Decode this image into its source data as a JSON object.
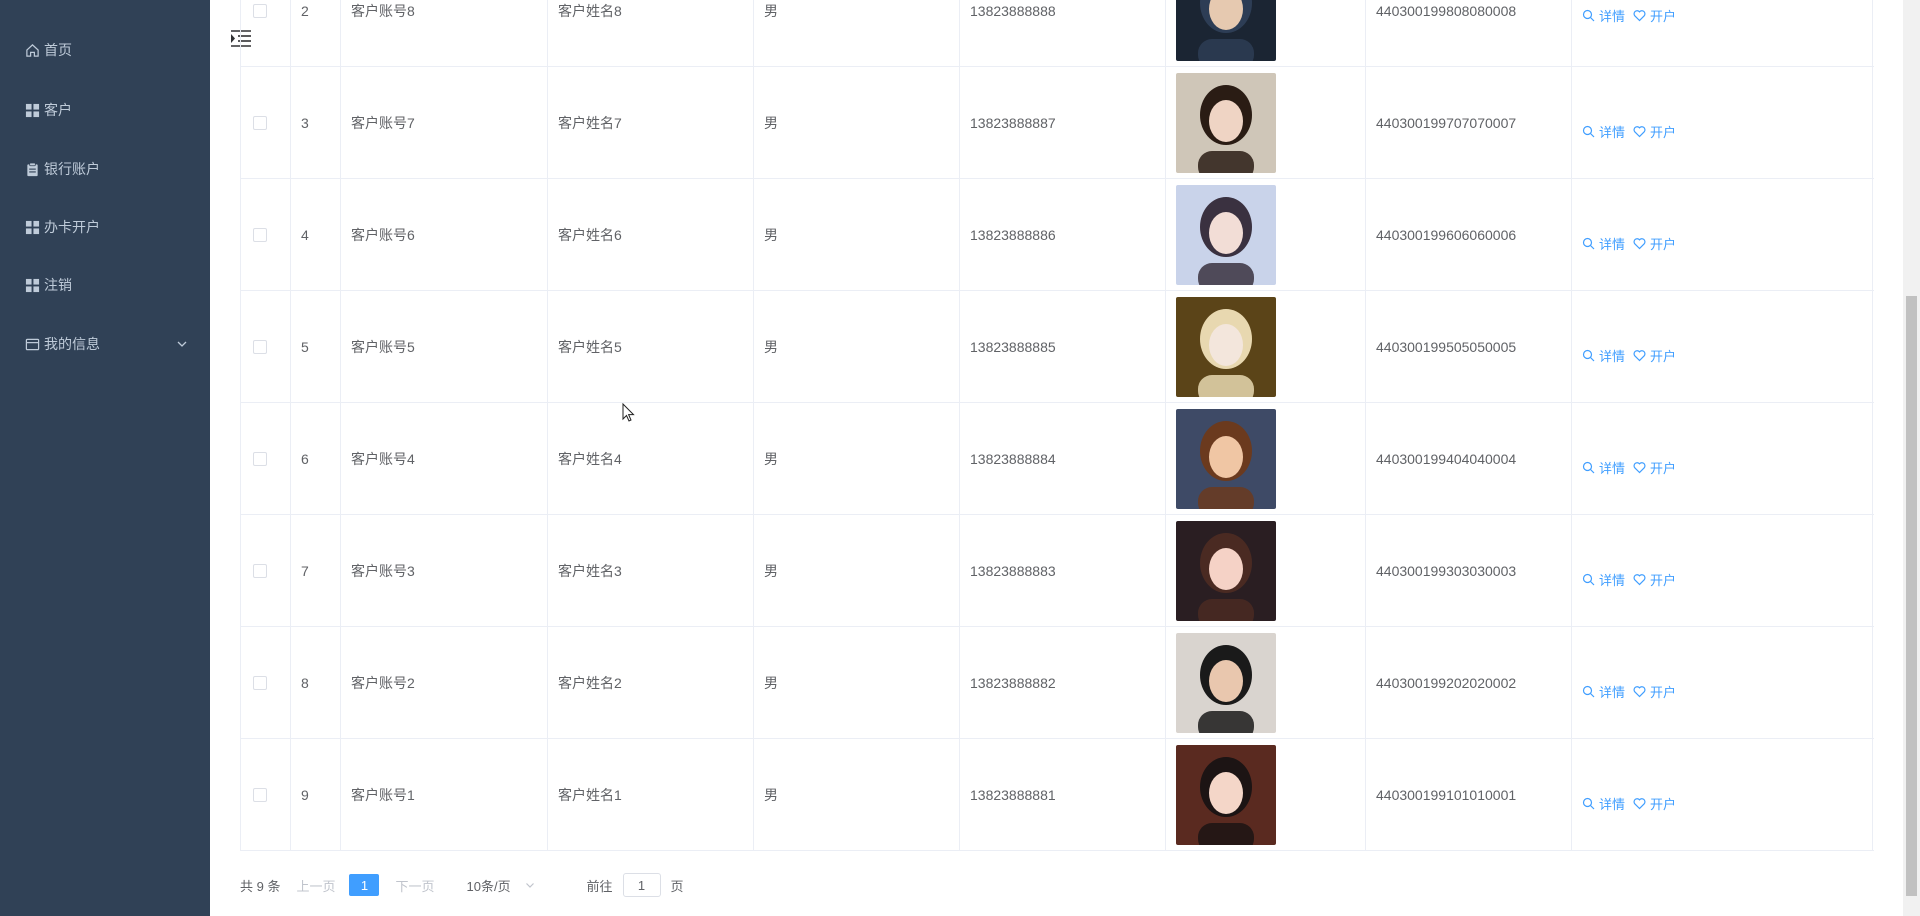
{
  "sidebar": {
    "items": [
      {
        "label": "首页",
        "icon": "home-icon"
      },
      {
        "label": "客户",
        "icon": "grid-icon"
      },
      {
        "label": "银行账户",
        "icon": "clipboard-icon"
      },
      {
        "label": "办卡开户",
        "icon": "grid-icon"
      },
      {
        "label": "注销",
        "icon": "grid-icon"
      },
      {
        "label": "我的信息",
        "icon": "id-card-icon",
        "expandable": true
      }
    ]
  },
  "table": {
    "rows": [
      {
        "index": "2",
        "account": "客户账号8",
        "name": "客户姓名8",
        "gender": "男",
        "phone": "13823888888",
        "id_number": "440300199808080008",
        "photo_colors": [
          "#1b2533",
          "#2d3d55",
          "#e6c9b0"
        ]
      },
      {
        "index": "3",
        "account": "客户账号7",
        "name": "客户姓名7",
        "gender": "男",
        "phone": "13823888887",
        "id_number": "440300199707070007",
        "photo_colors": [
          "#cfc6b8",
          "#2a1c14",
          "#efd4c4"
        ]
      },
      {
        "index": "4",
        "account": "客户账号6",
        "name": "客户姓名6",
        "gender": "男",
        "phone": "13823888886",
        "id_number": "440300199606060006",
        "photo_colors": [
          "#c9d3ea",
          "#3a3140",
          "#f2ddd6"
        ]
      },
      {
        "index": "5",
        "account": "客户账号5",
        "name": "客户姓名5",
        "gender": "男",
        "phone": "13823888885",
        "id_number": "440300199505050005",
        "photo_colors": [
          "#5b4418",
          "#e8d8b0",
          "#f3e6dc"
        ]
      },
      {
        "index": "6",
        "account": "客户账号4",
        "name": "客户姓名4",
        "gender": "男",
        "phone": "13823888884",
        "id_number": "440300199404040004",
        "photo_colors": [
          "#3e4a66",
          "#6b3a1e",
          "#f0c6a4"
        ]
      },
      {
        "index": "7",
        "account": "客户账号3",
        "name": "客户姓名3",
        "gender": "男",
        "phone": "13823888883",
        "id_number": "440300199303030003",
        "photo_colors": [
          "#2a1e22",
          "#4a2a22",
          "#f5d2c6"
        ]
      },
      {
        "index": "8",
        "account": "客户账号2",
        "name": "客户姓名2",
        "gender": "男",
        "phone": "13823888882",
        "id_number": "440300199202020002",
        "photo_colors": [
          "#d9d4cf",
          "#1a1a1a",
          "#e9c7ae"
        ]
      },
      {
        "index": "9",
        "account": "客户账号1",
        "name": "客户姓名1",
        "gender": "男",
        "phone": "13823888881",
        "id_number": "440300199101010001",
        "photo_colors": [
          "#5a2a20",
          "#1c1414",
          "#f4d6c8"
        ]
      }
    ],
    "actions": {
      "detail_label": "详情",
      "open_label": "开户"
    }
  },
  "pagination": {
    "total_text": "共 9 条",
    "prev_label": "上一页",
    "current_page": "1",
    "next_label": "下一页",
    "page_size": "10条/页",
    "goto_prefix": "前往",
    "goto_value": "1",
    "goto_suffix": "页"
  },
  "colors": {
    "sidebar_bg": "#304156",
    "sidebar_text": "#bfcbd9",
    "accent": "#409eff",
    "border": "#ebeef5"
  }
}
